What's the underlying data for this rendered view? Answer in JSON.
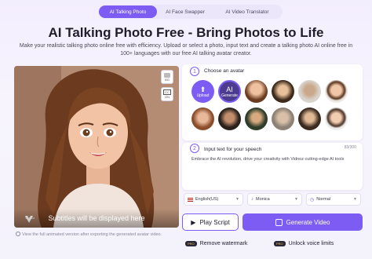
{
  "tabs": [
    {
      "label": "AI Talking Photo",
      "active": true
    },
    {
      "label": "AI Face Swapper",
      "active": false
    },
    {
      "label": "AI Video Translator",
      "active": false
    }
  ],
  "title": "AI Talking Photo Free - Bring Photos to Life",
  "subtitle": "Make your realistic talking photo online free with efficiency. Upload or select a photo, input text and create a talking photo AI online free in 100+ languages with our free AI talking avatar creator.",
  "photo": {
    "bg_label": "BG",
    "cc_label": "CC",
    "cc_state": "ON",
    "caption": "Subtitles will be displayed here",
    "logo_text": "Vidnoz"
  },
  "note": "View the full animated version after exporting the generated avatar video.",
  "step1": {
    "number": "1",
    "label": "Choose an avatar",
    "upload_label": "Upload",
    "generate_top": "AI",
    "generate_label": "Generate"
  },
  "step2": {
    "number": "2",
    "label": "Input text for your speech",
    "counter": "83/300",
    "text": "Embrace the AI revolution, drive your creativity with Vidnoz cutting-edge AI tools"
  },
  "selects": {
    "language": "English(US)",
    "voice": "Monica",
    "speed": "Normal"
  },
  "buttons": {
    "play": "Play Script",
    "generate": "Generate Video",
    "remove_watermark": "Remove watermark",
    "unlock_voice": "Unlock voice limits",
    "pro_badge": "PRO"
  },
  "colors": {
    "accent": "#7c5cf2"
  }
}
